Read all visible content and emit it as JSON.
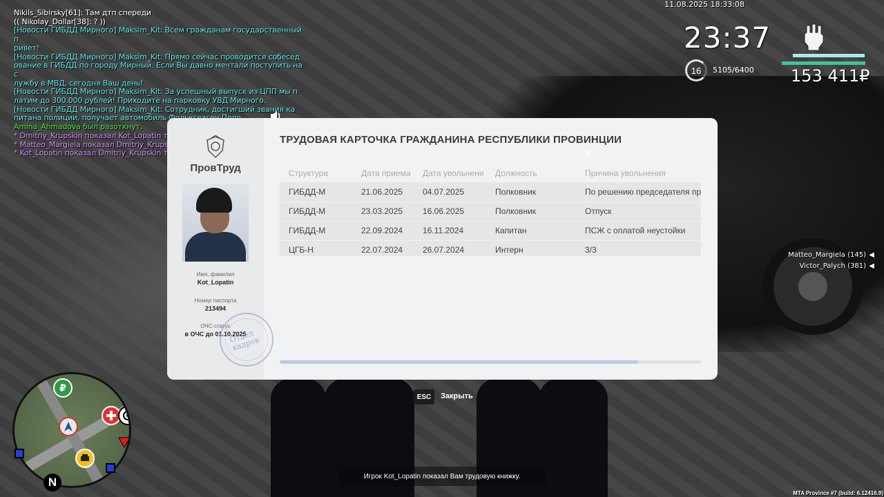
{
  "chat": [
    {
      "text": "Nikils_Sibirsky[61]: Там дтп спереди",
      "color": "#ffffff"
    },
    {
      "text": "(( Nikolay_Dollar[38]: ? ))",
      "color": "#ffffff"
    },
    {
      "text": "[Новости ГИБДД Мирного] Maksim_Kit: Всем гражданам государственный п",
      "color": "#5ee7e7"
    },
    {
      "text": "ривет!",
      "color": "#5ee7e7"
    },
    {
      "text": "[Новости ГИБДД Мирного] Maksim_Kit: Прямо сейчас проводится собесед",
      "color": "#5ee7e7"
    },
    {
      "text": "ование в ГИБДД по городу Мирный. Если Вы давно мечтали поступить на с",
      "color": "#5ee7e7"
    },
    {
      "text": "лужбу в МВД, сегодня Ваш день!",
      "color": "#5ee7e7"
    },
    {
      "text": "[Новости ГИБДД Мирного] Maksim_Kit: За успешный выпуск из ЦПП мы п",
      "color": "#5ee7e7"
    },
    {
      "text": "латим до 300.000 рублей! Приходите на парковку УВД Мирного.",
      "color": "#5ee7e7"
    },
    {
      "text": "[Новости ГИБДД Мирного] Maksim_Kit: Сотрудник, достигший звания ка",
      "color": "#5ee7e7"
    },
    {
      "text": "питана полиции, получает автомобиль Фольксваген Поло.",
      "color": "#5ee7e7"
    },
    {
      "text": "Amina_Ahmadova был разоткнут.",
      "color": "#41e641"
    },
    {
      "text": "* Dmitriy_Krupskin показал Kot_Lopatin трудовую книжку",
      "color": "#d08cf4"
    },
    {
      "text": "* Matteo_Margiela показал Dmitriy_Krupskin трудовую книжку",
      "color": "#d08cf4"
    },
    {
      "text": "* Kot_Lopatin показал Dmitriy_Krupskin трудовую книжку",
      "color": "#d08cf4"
    }
  ],
  "hud": {
    "datetime": "11.08.2025 18:33:08",
    "clock": "23:37",
    "level": "16",
    "xp": "5105/6400",
    "money": "153 411₽",
    "health_colors": {
      "health": "#a8ece5",
      "armor": "#3fc39a"
    }
  },
  "nearby_players": [
    {
      "label": "Matteo_Margiela (145)",
      "icon": "speaker-icon"
    },
    {
      "label": "Victor_Palych (381)",
      "icon": "speaker-icon"
    }
  ],
  "card": {
    "org": "ПровТруд",
    "title": "ТРУДОВАЯ КАРТОЧКА ГРАЖДАНИНА РЕСПУБЛИКИ ПРОВИНЦИИ",
    "name_label": "Имя, фамилия",
    "name_value": "Kot_Lopatin",
    "passport_label": "Номер паспорта",
    "passport_value": "213494",
    "ochs_label": "ОЧС-статус",
    "ochs_value": "в ОЧС до 01.10.2025",
    "stamp_text_1": "Отдел",
    "stamp_text_2": "кадров",
    "columns": [
      "Структура",
      "Дата приема",
      "Дата увольнени",
      "Должность",
      "Причина увольнения"
    ],
    "rows": [
      [
        "ГИБДД-М",
        "21.06.2025",
        "04.07.2025",
        "Полковник",
        "По решению председателя пр"
      ],
      [
        "ГИБДД-М",
        "23.03.2025",
        "16.06.2025",
        "Полковник",
        "Отпуск"
      ],
      [
        "ГИБДД-М",
        "22.09.2024",
        "16.11.2024",
        "Капитан",
        "ПСЖ с оплатой неустойки"
      ],
      [
        "ЦГБ-Н",
        "22.07.2024",
        "26.07.2024",
        "Интерн",
        "3/3"
      ]
    ],
    "scroll_progress": 0.85
  },
  "esc_key": "ESC",
  "close_label": "Закрыть",
  "notice": "Игрок Kot_Lopatin показал Вам трудовую книжку.",
  "build": "MTA Province #7 (build: 6.12416.9)",
  "radar": {
    "north": "N",
    "ruble_symbol": "₽"
  }
}
